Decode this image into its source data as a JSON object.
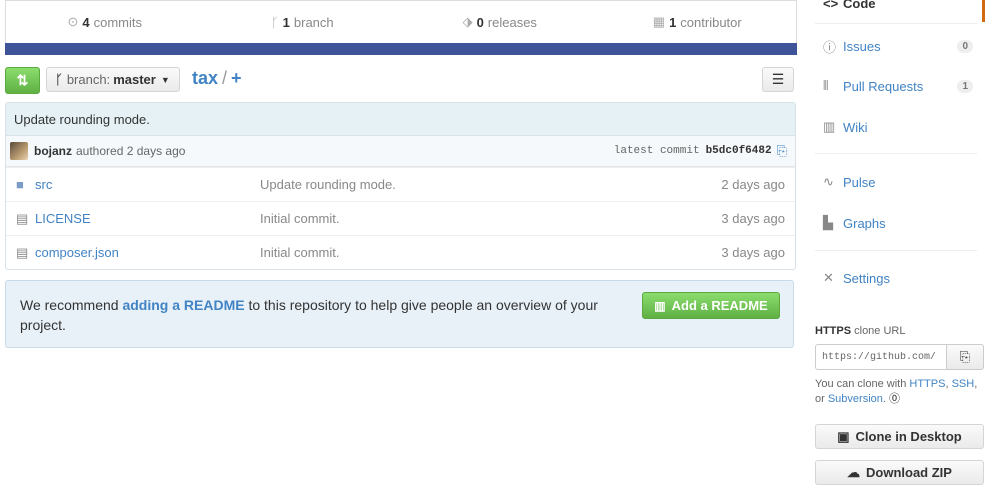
{
  "stats": {
    "commits": {
      "count": "4",
      "label": "commits",
      "icon": "history-icon"
    },
    "branches": {
      "count": "1",
      "label": "branch",
      "icon": "branch-icon"
    },
    "releases": {
      "count": "0",
      "label": "releases",
      "icon": "tag-icon"
    },
    "contributors": {
      "count": "1",
      "label": "contributor",
      "icon": "organization-icon"
    }
  },
  "language_bar_color": "#3f5498",
  "file_nav": {
    "branch_prefix": "branch:",
    "branch_name": "master",
    "repo_name": "tax",
    "separator": "/",
    "add_symbol": "+"
  },
  "commit": {
    "title": "Update rounding mode.",
    "author": "bojanz",
    "authored_text": "authored 2 days ago",
    "latest_label": "latest commit",
    "sha": "b5dc0f6482"
  },
  "files": [
    {
      "type": "directory",
      "name": "src",
      "message": "Update rounding mode.",
      "age": "2 days ago"
    },
    {
      "type": "file",
      "name": "LICENSE",
      "message": "Initial commit.",
      "age": "3 days ago"
    },
    {
      "type": "file",
      "name": "composer.json",
      "message": "Initial commit.",
      "age": "3 days ago"
    }
  ],
  "readme_prompt": {
    "before": "We recommend ",
    "link": "adding a README",
    "after": " to this repository to help give people an overview of your project.",
    "button": "Add a README"
  },
  "sidebar": {
    "nav": [
      {
        "label": "Code",
        "icon": "code-icon",
        "selected": true
      },
      {
        "label": "Issues",
        "icon": "issue-icon",
        "count": "0"
      },
      {
        "label": "Pull Requests",
        "icon": "pull-request-icon",
        "count": "1"
      },
      {
        "label": "Wiki",
        "icon": "book-icon"
      },
      {
        "label": "Pulse",
        "icon": "pulse-icon"
      },
      {
        "label": "Graphs",
        "icon": "graph-icon"
      },
      {
        "label": "Settings",
        "icon": "tools-icon"
      }
    ],
    "clone": {
      "protocol": "HTTPS",
      "label": "clone URL",
      "url": "https://github.com/",
      "help_prefix": "You can clone with ",
      "https": "HTTPS",
      "ssh": "SSH",
      "or": "or",
      "subversion": "Subversion"
    },
    "buttons": {
      "desktop": "Clone in Desktop",
      "zip": "Download ZIP"
    }
  },
  "accent_color": "#d26911"
}
